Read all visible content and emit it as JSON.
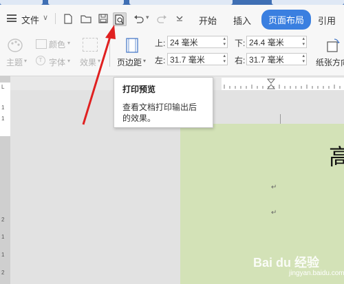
{
  "quick_bar": {
    "file_label": "文件",
    "caret": "∨"
  },
  "ribbon_tabs": [
    {
      "label": "开始"
    },
    {
      "label": "插入"
    },
    {
      "label": "页面布局"
    },
    {
      "label": "引用"
    }
  ],
  "theme_group": {
    "theme": "主题",
    "color": "颜色",
    "font": "字体",
    "effect": "效果"
  },
  "margins": {
    "button_label": "页边距",
    "top_label": "上:",
    "top_value": "24 毫米",
    "bottom_label": "下:",
    "bottom_value": "24.4 毫米",
    "left_label": "左:",
    "left_value": "31.7 毫米",
    "right_label": "右:",
    "right_value": "31.7 毫米"
  },
  "orientation": {
    "label": "纸张方向"
  },
  "tooltip": {
    "title": "打印预览",
    "body": "查看文档打印输出后的效果。"
  },
  "document": {
    "heading_char": "高",
    "para_mark": "↵"
  },
  "watermark": {
    "brand": "Bai du 经验",
    "url": "jingyan.baidu.com"
  },
  "colors": {
    "accent": "#3a7fe0",
    "page": "#d3e2b7",
    "arrow": "#e02020"
  }
}
